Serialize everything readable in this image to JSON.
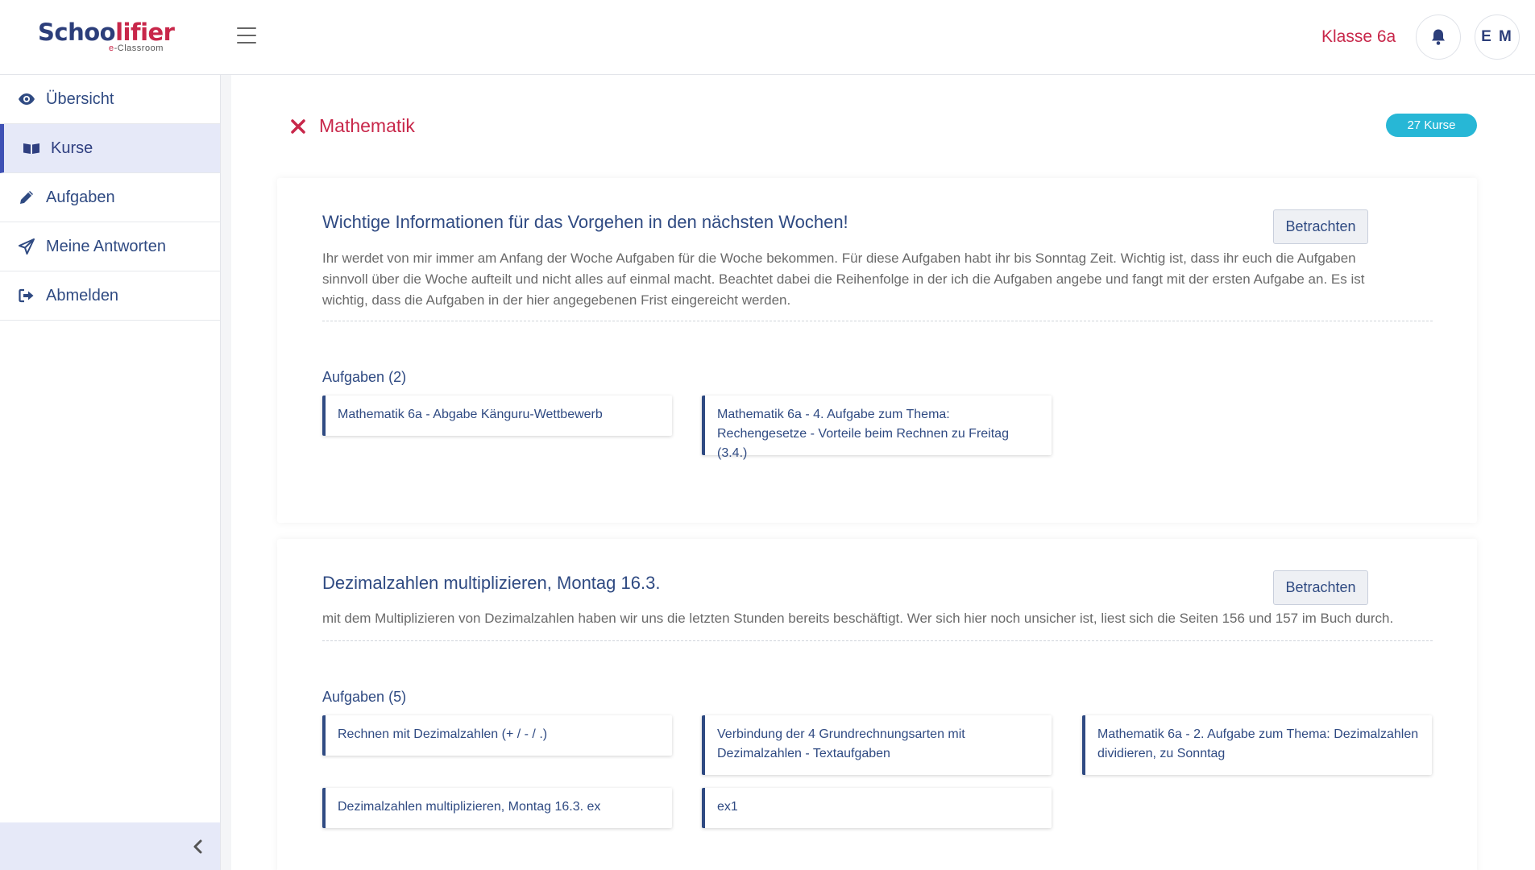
{
  "header": {
    "logo_main_part1": "Schoo",
    "logo_main_part2": "lifier",
    "logo_sub_e": "e",
    "logo_sub_rest": "-Classroom",
    "class_label": "Klasse 6a",
    "avatar_initials": "E M"
  },
  "sidebar": {
    "items": [
      {
        "label": "Übersicht",
        "icon": "eye-icon"
      },
      {
        "label": "Kurse",
        "icon": "book-icon"
      },
      {
        "label": "Aufgaben",
        "icon": "pencil-icon"
      },
      {
        "label": "Meine Antworten",
        "icon": "paper-plane-icon"
      },
      {
        "label": "Abmelden",
        "icon": "sign-out-icon"
      }
    ],
    "active_index": 1
  },
  "main": {
    "course_name": "Mathematik",
    "course_count_badge": "27 Kurse",
    "cards": [
      {
        "title": "Wichtige Informationen für das Vorgehen in den nächsten Wochen!",
        "button_label": "Betrachten",
        "text_line1": "Ihr werdet von mir immer am Anfang der Woche Aufgaben für die Woche bekommen. Für diese Aufgaben habt ihr bis Sonntag Zeit. Wichtig ist, dass ihr euch die Aufgaben",
        "text_line2": "sinnvoll über die Woche aufteilt und nicht alles auf einmal macht. Beachtet dabei die Reihenfolge in der ich die Aufgaben angebe und fangt mit der ersten Aufgabe an. Es ist",
        "text_line3": "wichtig, dass die Aufgaben in der hier angegebenen Frist eingereicht werden.",
        "tasks_label": "Aufgaben (2)",
        "tasks": [
          {
            "line1": "Mathematik 6a - Abgabe Känguru-Wettbewerb",
            "line2": ""
          },
          {
            "line1": "Mathematik 6a - 4. Aufgabe zum Thema:",
            "line2": "Rechengesetze - Vorteile beim Rechnen zu Freitag (3.4.)"
          }
        ]
      },
      {
        "title": "Dezimalzahlen multiplizieren, Montag 16.3.",
        "button_label": "Betrachten",
        "text_line1": "mit dem Multiplizieren von Dezimalzahlen haben wir uns die letzten Stunden bereits beschäftigt. Wer sich hier noch unsicher ist, liest sich die Seiten 156 und 157 im Buch durch.",
        "tasks_label": "Aufgaben (5)",
        "tasks": [
          {
            "line1": "Rechnen mit Dezimalzahlen (+ / - / .)",
            "line2": ""
          },
          {
            "line1": "Verbindung der 4 Grundrechnungsarten mit",
            "line2": "Dezimalzahlen - Textaufgaben"
          },
          {
            "line1": "Mathematik 6a - 2. Aufgabe zum Thema: Dezimalzahlen",
            "line2": "dividieren, zu Sonntag"
          },
          {
            "line1": "Dezimalzahlen multiplizieren, Montag 16.3. ex",
            "line2": ""
          },
          {
            "line1": "ex1",
            "line2": ""
          }
        ]
      }
    ]
  },
  "colors": {
    "brand_navy": "#2c3e7a",
    "brand_red": "#c8274a",
    "badge_cyan": "#27b7d6",
    "active_nav_bg": "#e6e9f8",
    "active_nav_border": "#3f51b5"
  }
}
